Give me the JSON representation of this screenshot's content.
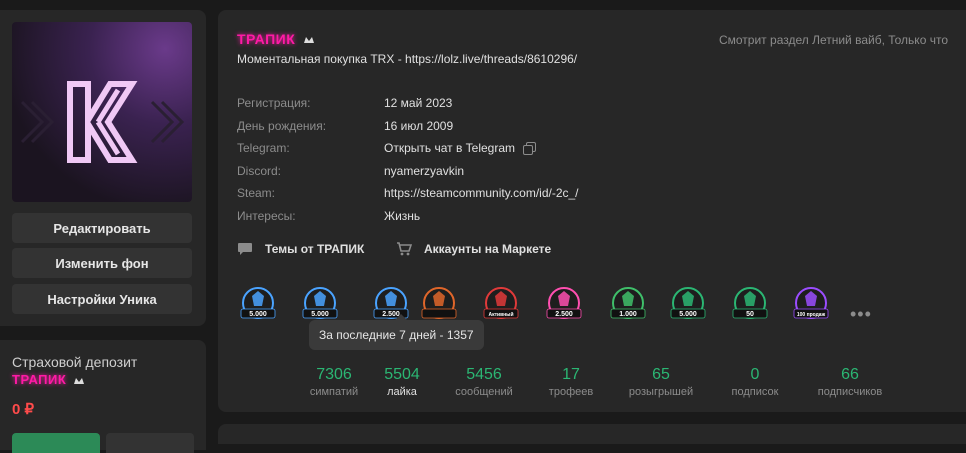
{
  "sidebar": {
    "buttons": [
      "Редактировать",
      "Изменить фон",
      "Настройки Уника"
    ],
    "deposit": {
      "title": "Страховой депозит",
      "username": "ТРАПИК",
      "amount": "0 ₽"
    }
  },
  "profile": {
    "username": "ТРАПИК",
    "status": "Моментальная покупка TRX - https://lolz.live/threads/8610296/",
    "viewing": "Смотрит раздел Летний вайб, Только что",
    "info": [
      {
        "label": "Регистрация:",
        "value": "12 май 2023"
      },
      {
        "label": "День рождения:",
        "value": "16 июл 2009"
      },
      {
        "label": "Telegram:",
        "value": "Открыть чат в Telegram"
      },
      {
        "label": "Discord:",
        "value": "nyamerzyavkin"
      },
      {
        "label": "Steam:",
        "value": "https://steamcommunity.com/id/-2c_/"
      },
      {
        "label": "Интересы:",
        "value": "Жизнь"
      }
    ],
    "links": {
      "threads": "Темы от ТРАПИК",
      "market": "Аккаунты на Маркете"
    },
    "trophies": [
      {
        "icon": "like-5000-trophy-icon",
        "text": "5.000",
        "color": "#4aa3ff"
      },
      {
        "icon": "messages-5000-trophy-icon",
        "text": "5.000",
        "color": "#4aa3ff"
      },
      {
        "icon": "messages-2500-trophy-icon",
        "text": "2.500",
        "color": "#4aa3ff"
      },
      {
        "icon": "helmet-trophy-icon",
        "text": "",
        "color": "#e0662a"
      },
      {
        "icon": "active-trophy-icon",
        "text": "Активный",
        "color": "#e03a3a"
      },
      {
        "icon": "like-2500-trophy-icon",
        "text": "2.500",
        "color": "#ff4fb0"
      },
      {
        "icon": "like-1000-trophy-icon",
        "text": "1.000",
        "color": "#3fbf6a"
      },
      {
        "icon": "heart-5000-trophy-icon",
        "text": "5.000",
        "color": "#2bb673"
      },
      {
        "icon": "referrals-50-trophy-icon",
        "text": "50",
        "color": "#2bb673"
      },
      {
        "icon": "sales-trophy-icon",
        "text": "100 продаж",
        "color": "#9b4dff"
      }
    ],
    "more": "•••",
    "tooltip": "За последние 7 дней - 1357",
    "stats": [
      {
        "value": "7306",
        "label": "симпатий"
      },
      {
        "value": "5504",
        "label": "лайка"
      },
      {
        "value": "5456",
        "label": "сообщений"
      },
      {
        "value": "17",
        "label": "трофеев"
      },
      {
        "value": "65",
        "label": "розыгрышей"
      },
      {
        "value": "0",
        "label": "подписок"
      },
      {
        "value": "66",
        "label": "подписчиков"
      }
    ]
  },
  "colors": {
    "accent": "#2bb673",
    "username": "#ff1aa6",
    "danger": "#ff4b4b"
  }
}
